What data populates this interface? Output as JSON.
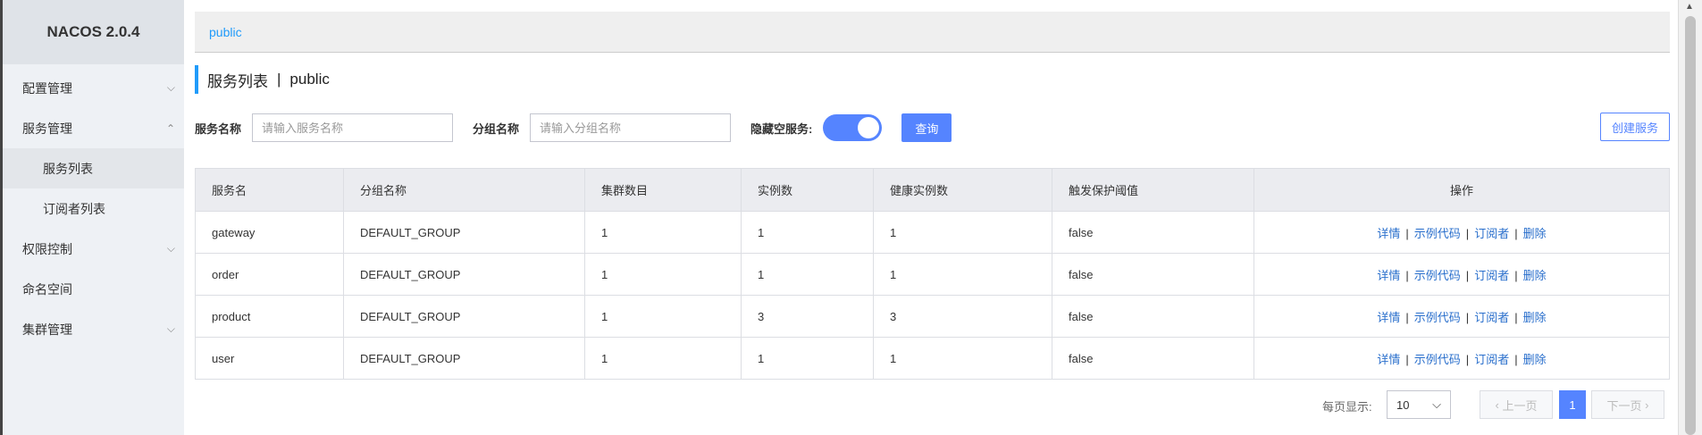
{
  "sidebar": {
    "logo": "NACOS 2.0.4",
    "items": [
      {
        "label": "配置管理",
        "chevron": "⌵"
      },
      {
        "label": "服务管理",
        "chevron": "⌃"
      },
      {
        "label": "服务列表"
      },
      {
        "label": "订阅者列表"
      },
      {
        "label": "权限控制",
        "chevron": "⌵"
      },
      {
        "label": "命名空间"
      },
      {
        "label": "集群管理",
        "chevron": "⌵"
      }
    ]
  },
  "namespace_bar": {
    "label": "public"
  },
  "page_header": {
    "title": "服务列表",
    "separator": "|",
    "namespace": "public"
  },
  "filter": {
    "service_name_label": "服务名称",
    "service_name_placeholder": "请输入服务名称",
    "group_name_label": "分组名称",
    "group_name_placeholder": "请输入分组名称",
    "hide_empty_label": "隐藏空服务:",
    "hide_empty_on": true,
    "query_button": "查询",
    "create_button": "创建服务"
  },
  "table": {
    "headers": [
      "服务名",
      "分组名称",
      "集群数目",
      "实例数",
      "健康实例数",
      "触发保护阈值",
      "操作"
    ],
    "rows": [
      {
        "name": "gateway",
        "group": "DEFAULT_GROUP",
        "clusters": "1",
        "instances": "1",
        "healthy": "1",
        "protect": "false"
      },
      {
        "name": "order",
        "group": "DEFAULT_GROUP",
        "clusters": "1",
        "instances": "1",
        "healthy": "1",
        "protect": "false"
      },
      {
        "name": "product",
        "group": "DEFAULT_GROUP",
        "clusters": "1",
        "instances": "3",
        "healthy": "3",
        "protect": "false"
      },
      {
        "name": "user",
        "group": "DEFAULT_GROUP",
        "clusters": "1",
        "instances": "1",
        "healthy": "1",
        "protect": "false"
      }
    ],
    "actions": {
      "detail": "详情",
      "sample": "示例代码",
      "subscriber": "订阅者",
      "delete": "删除",
      "sep": "|"
    }
  },
  "pagination": {
    "page_size_label": "每页显示:",
    "page_size": "10",
    "prev": "上一页",
    "current": "1",
    "next": "下一页"
  },
  "colors": {
    "accent": "#5584ff",
    "link": "#2a6fcc",
    "namespace": "#209bfa"
  }
}
